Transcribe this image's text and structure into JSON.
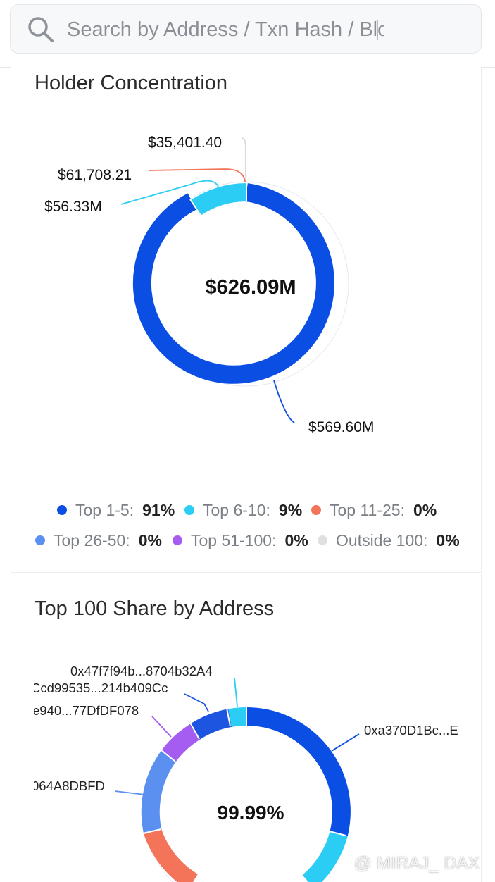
{
  "search": {
    "placeholder": "Search by Address / Txn Hash / Block / Token"
  },
  "holder_concentration": {
    "title": "Holder Concentration",
    "center_value": "$626.09M",
    "callouts": {
      "top_1_5": "$569.60M",
      "top_6_10": "$56.33M",
      "top_11_25": "$61,708.21",
      "outside_100": "$35,401.40"
    },
    "legend": [
      {
        "label": "Top 1-5:",
        "value": "91%",
        "color": "#0a4ee4"
      },
      {
        "label": "Top 6-10:",
        "value": "9%",
        "color": "#2ccdf5"
      },
      {
        "label": "Top 11-25:",
        "value": "0%",
        "color": "#f47459"
      },
      {
        "label": "Top 26-50:",
        "value": "0%",
        "color": "#5b8ff0"
      },
      {
        "label": "Top 51-100:",
        "value": "0%",
        "color": "#a55cf0"
      },
      {
        "label": "Outside 100:",
        "value": "0%",
        "color": "#e0e0e0"
      }
    ]
  },
  "top100": {
    "title": "Top 100 Share by Address",
    "center_value": "99.99%",
    "labels": {
      "addr1": "0xa370D1Bc...E",
      "addr2": "0x47f7f94b...8704b32A4",
      "addr3": "Ccd99535...214b409Cc",
      "addr4": "e940...77DfDF078",
      "addr5": "064A8DBFD"
    }
  },
  "watermark": "@ MIRAJ_ DAX"
}
